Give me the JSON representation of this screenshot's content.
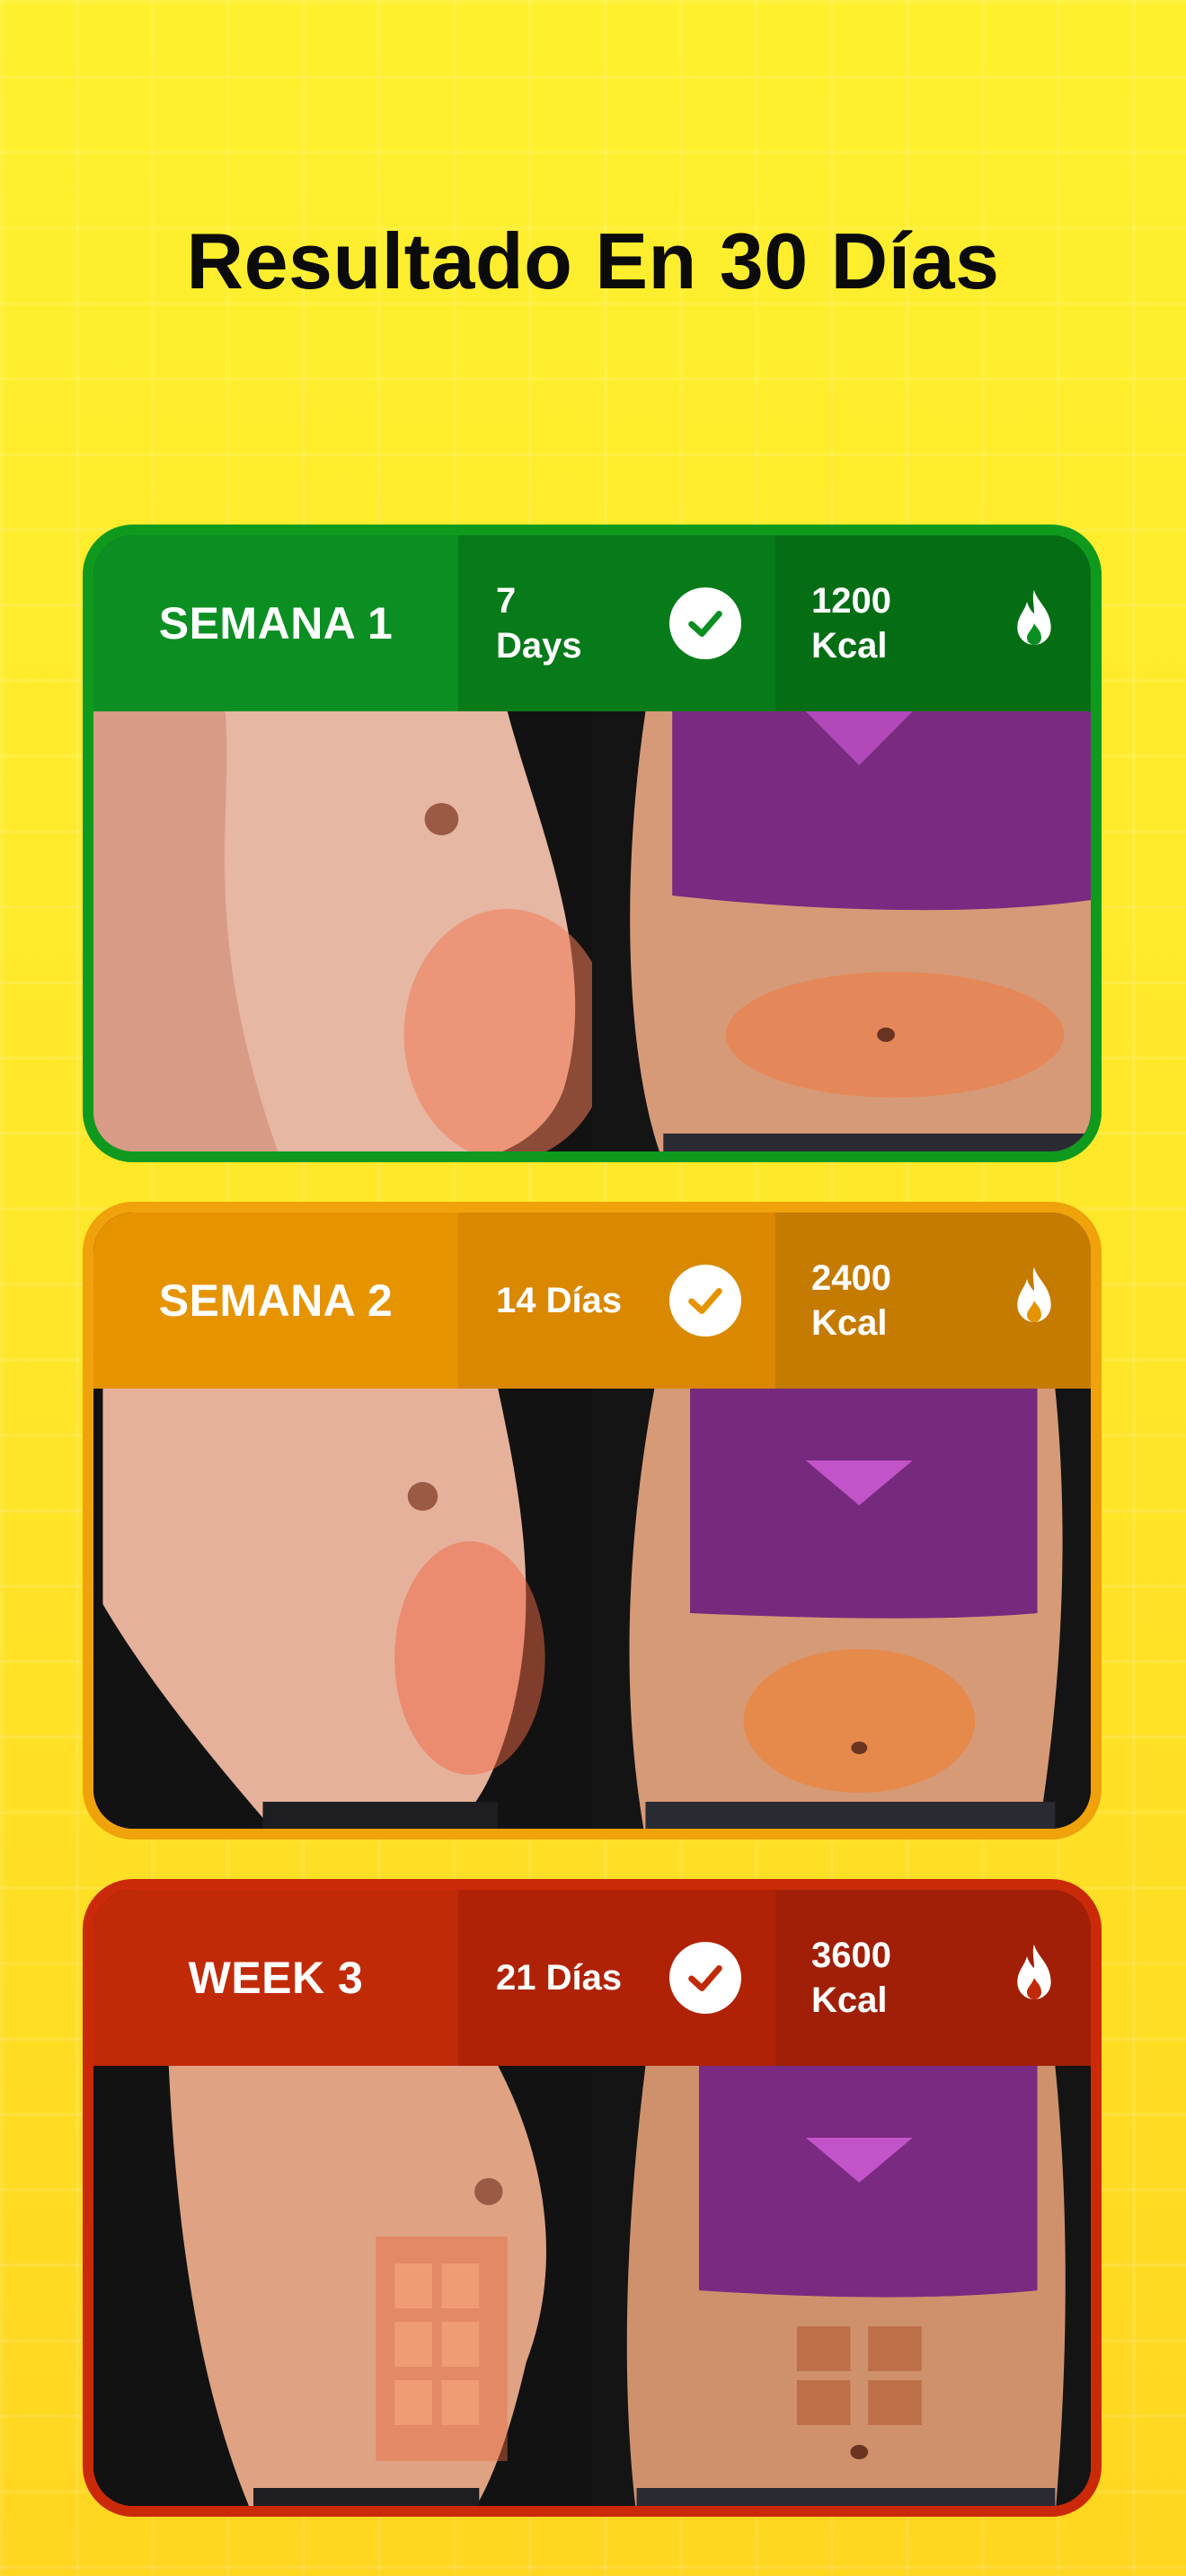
{
  "page": {
    "title": "Resultado En 30 Días"
  },
  "cards": [
    {
      "week_label": "SEMANA 1",
      "days_line1": "7",
      "days_line2": "Days",
      "kcal_line1": "1200",
      "kcal_line2": "Kcal",
      "color": "#0B8F22",
      "check_icon": "check-circle-icon",
      "flame_icon": "flame-icon"
    },
    {
      "week_label": "SEMANA 2",
      "days_line1": "14 Días",
      "days_line2": "",
      "kcal_line1": "2400",
      "kcal_line2": "Kcal",
      "color": "#E69300",
      "check_icon": "check-circle-icon",
      "flame_icon": "flame-icon"
    },
    {
      "week_label": "WEEK 3",
      "days_line1": "21 Días",
      "days_line2": "",
      "kcal_line1": "3600",
      "kcal_line2": "Kcal",
      "color": "#C12A07",
      "check_icon": "check-circle-icon",
      "flame_icon": "flame-icon"
    }
  ]
}
